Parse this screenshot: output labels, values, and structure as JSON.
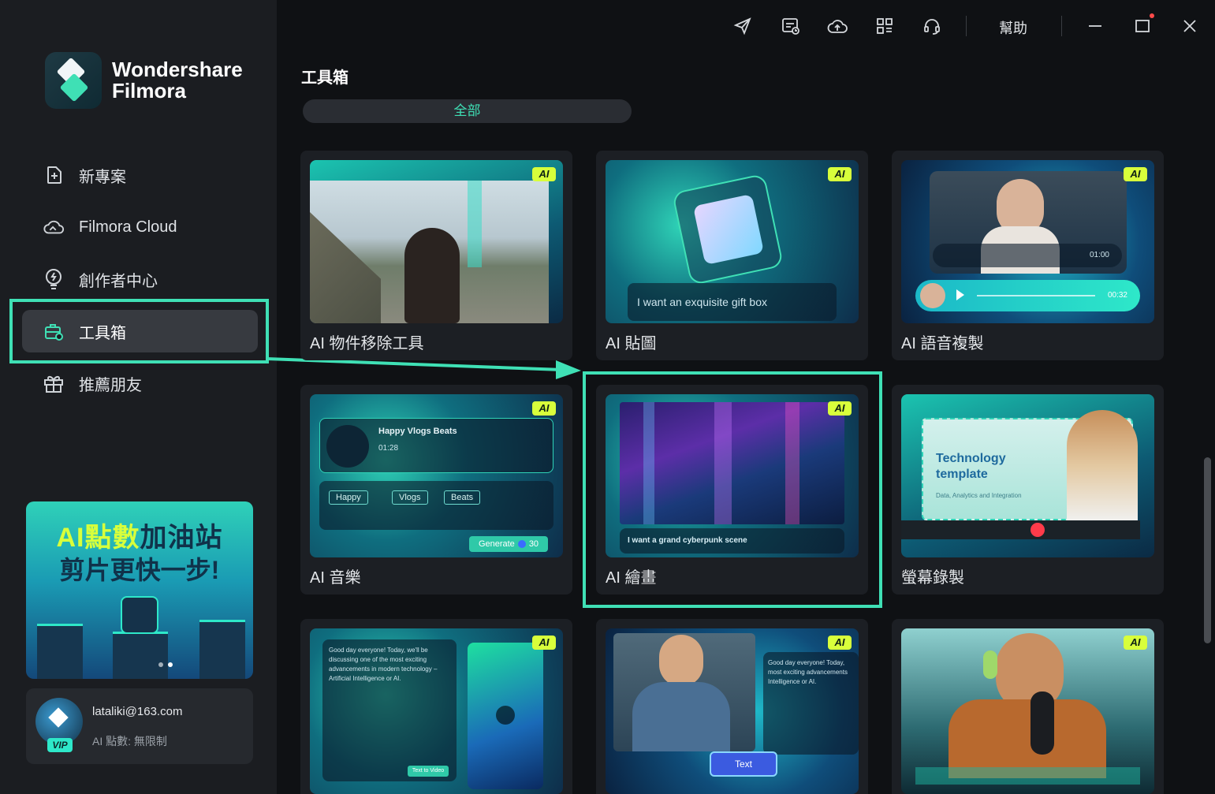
{
  "app": {
    "logo_line1": "Wondershare",
    "logo_line2": "Filmora"
  },
  "titlebar": {
    "icons": [
      "send-icon",
      "calendar-clock-icon",
      "cloud-upload-icon",
      "grid-icon",
      "headset-icon"
    ],
    "help": "幫助"
  },
  "sidebar": {
    "items": [
      {
        "label": "新專案",
        "icon": "plus-box-icon"
      },
      {
        "label": "Filmora Cloud",
        "icon": "cloud-icon"
      },
      {
        "label": "創作者中心",
        "icon": "lightbulb-icon"
      },
      {
        "label": "工具箱",
        "icon": "toolbox-icon",
        "active": true
      },
      {
        "label": "推薦朋友",
        "icon": "gift-icon"
      }
    ]
  },
  "promo": {
    "line1_highlight": "AI點數",
    "line1_rest": "加油站",
    "line2": "剪片更快一步!"
  },
  "account": {
    "email": "lataliki@163.com",
    "points": "AI 點數: 無限制",
    "badge": "VIP"
  },
  "main": {
    "title": "工具箱",
    "filter": "全部",
    "ai_badge": "AI",
    "cards": [
      {
        "label": "AI 物件移除工具",
        "ai": true
      },
      {
        "label": "AI 貼圖",
        "ai": true,
        "prompt": "I want an exquisite gift box"
      },
      {
        "label": "AI 語音複製",
        "ai": true,
        "time1": "01:00",
        "time2": "00:32"
      },
      {
        "label": "AI 音樂",
        "ai": true,
        "track": "Happy Vlogs Beats",
        "duration": "01:28",
        "tags": [
          "Happy",
          "Vlogs",
          "Beats"
        ],
        "generate": "Generate",
        "cost": "30"
      },
      {
        "label": "AI 繪畫",
        "ai": true,
        "prompt": "I want a grand cyberpunk scene"
      },
      {
        "label": "螢幕錄製",
        "ai": false,
        "slide_title": "Technology template",
        "slide_sub": "Data, Analytics and Integration"
      },
      {
        "label": "",
        "ai": true,
        "text": "Good day everyone! Today, we'll be discussing one of the most exciting advancements in modern technology – Artificial Intelligence or AI.",
        "button": "Text to Video"
      },
      {
        "label": "",
        "ai": true,
        "text": "Good day everyone! Today, most exciting advancements Intelligence or AI.",
        "chip": "Text"
      },
      {
        "label": "",
        "ai": true
      }
    ]
  }
}
